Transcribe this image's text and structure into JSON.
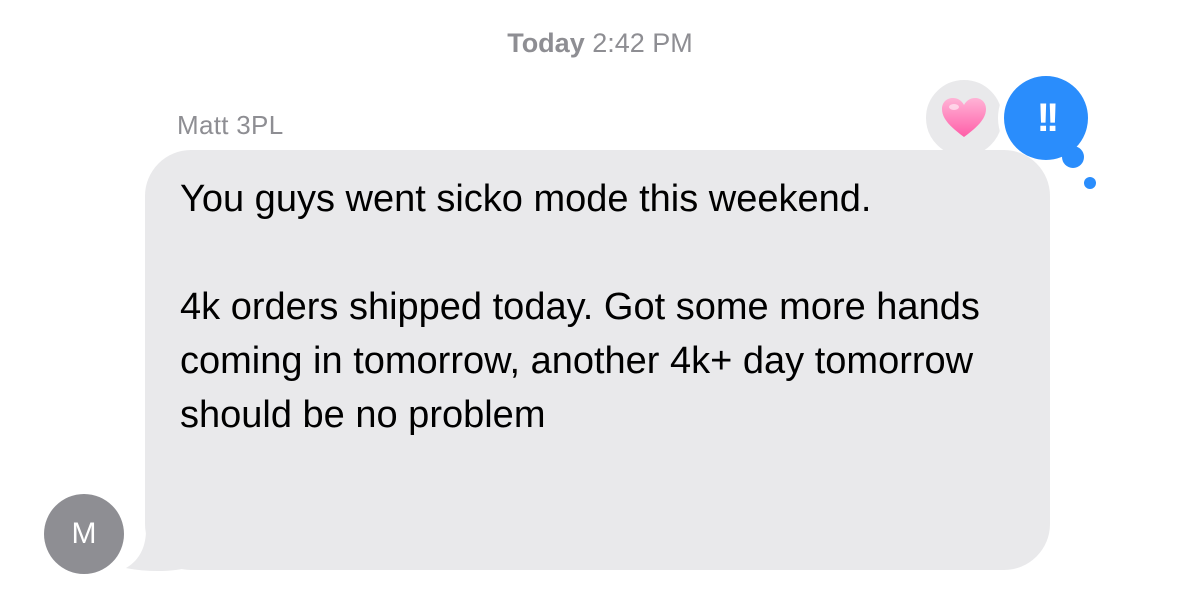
{
  "timestamp": {
    "day": "Today",
    "time": "2:42 PM"
  },
  "message": {
    "sender_name": "Matt 3PL",
    "avatar_initial": "M",
    "paragraphs": [
      "You guys went sicko mode this weekend.",
      "4k orders shipped today. Got some more hands coming in tomorrow, another 4k+ day tomorrow should be no problem"
    ],
    "bubble_color": "#e9e9eb"
  },
  "reactions": [
    {
      "type": "heart-icon",
      "color": "#ff7fb5"
    },
    {
      "type": "double-exclamation-icon",
      "label": "!!",
      "color": "#2a8dfc"
    }
  ]
}
